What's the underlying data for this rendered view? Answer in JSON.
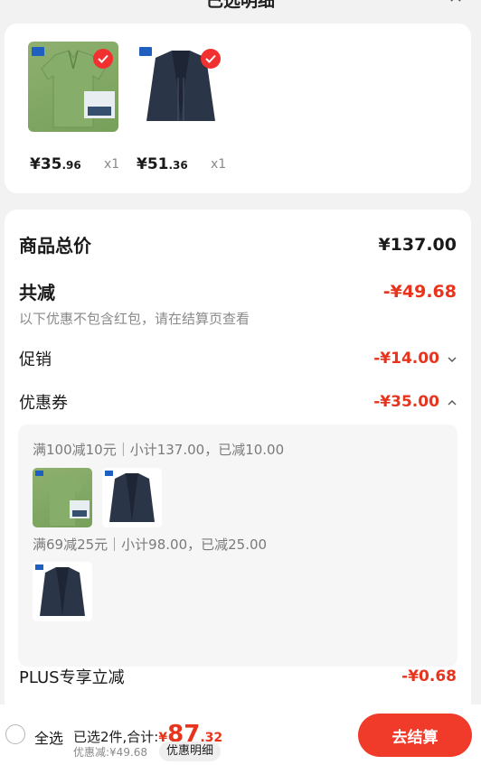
{
  "header": {
    "title": "已选明细"
  },
  "products": [
    {
      "price_int": "¥35",
      "price_dec": ".96",
      "qty": "x1"
    },
    {
      "price_int": "¥51",
      "price_dec": ".36",
      "qty": "x1"
    }
  ],
  "summary": {
    "total_label": "商品总价",
    "total_value": "¥137.00",
    "reduce_label": "共减",
    "reduce_value": "-¥49.68",
    "note": "以下优惠不包含红包，请在结算页查看",
    "promo_label": "促销",
    "promo_value": "-¥14.00",
    "coupon_label": "优惠券",
    "coupon_value": "-¥35.00",
    "plus_label": "PLUS专享立减",
    "plus_value": "-¥0.68"
  },
  "coupons": [
    {
      "rule": "满100减10元｜小计137.00，已减10.00"
    },
    {
      "rule": "满69减25元｜小计98.00，已减25.00"
    }
  ],
  "bottom": {
    "select_all": "全选",
    "selected": "已选2件,合计:",
    "cur": "¥",
    "price_int": "87",
    "price_dec": ".32",
    "discount": "优惠减:¥49.68",
    "detail_btn": "优惠明细",
    "checkout_btn": "去结算"
  },
  "colors": {
    "accent_red": "#e8341c",
    "checkout_red": "#f03a2a",
    "green_shirt": "#7ea363",
    "navy_jacket": "#2b3548"
  }
}
